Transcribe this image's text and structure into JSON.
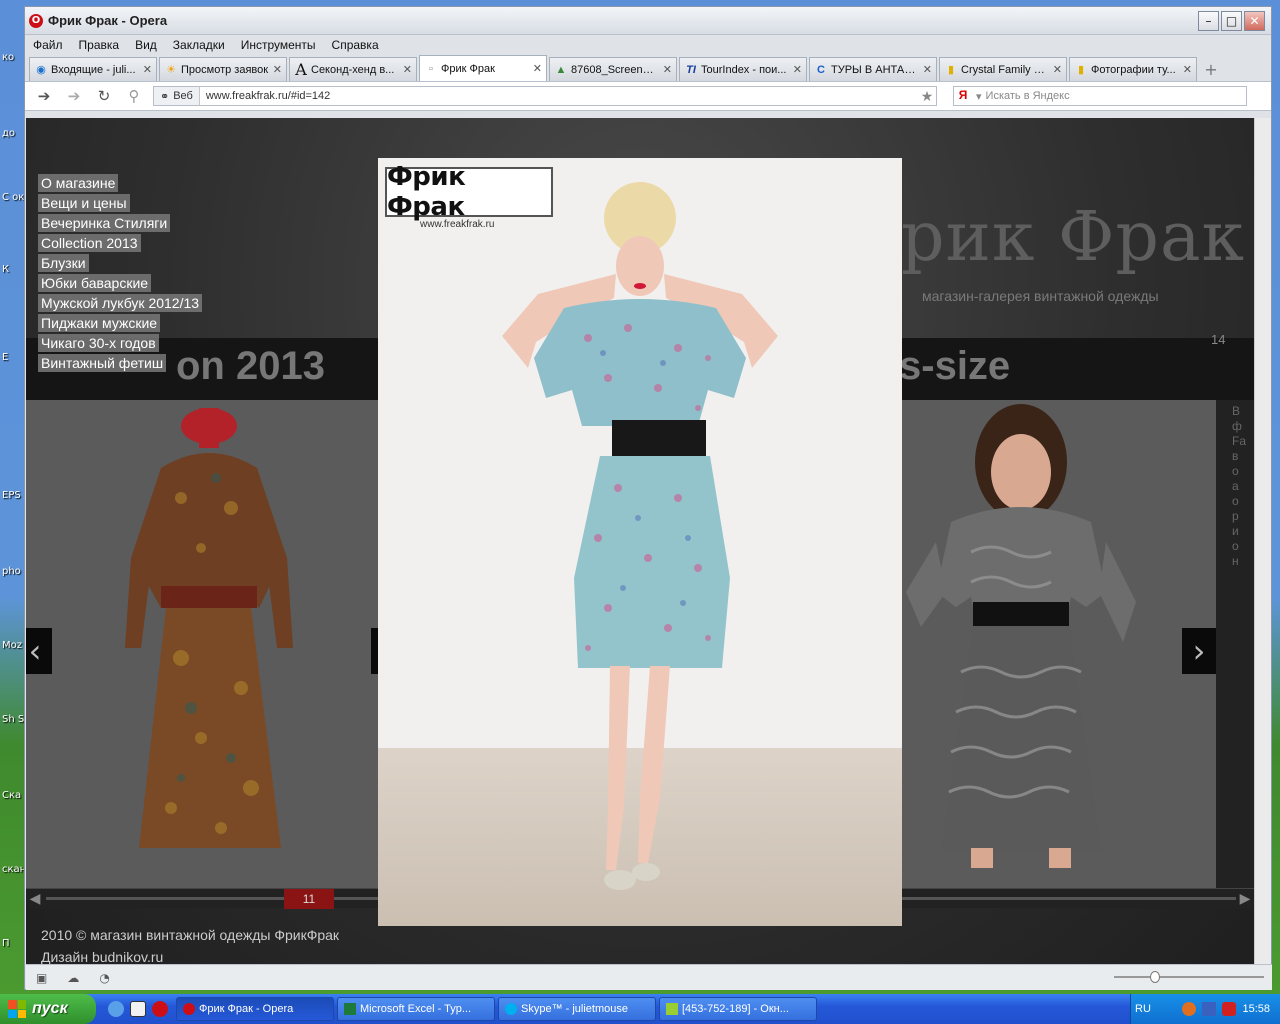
{
  "window": {
    "title": "Фрик Фрак - Opera"
  },
  "menu": [
    "Файл",
    "Правка",
    "Вид",
    "Закладки",
    "Инструменты",
    "Справка"
  ],
  "tabs": [
    {
      "label": "Входящие - juli...",
      "icon": "mail-icon",
      "active": false
    },
    {
      "label": "Просмотр заявок",
      "icon": "sun-icon",
      "active": false
    },
    {
      "label": "Секонд-хенд в...",
      "icon": "font-a-icon",
      "active": false
    },
    {
      "label": "Фрик Фрак",
      "icon": "page-icon",
      "active": true
    },
    {
      "label": "87608_ScreenS...",
      "icon": "image-icon",
      "active": false
    },
    {
      "label": "TourIndex - пои...",
      "icon": "tourindex-icon",
      "active": false
    },
    {
      "label": "ТУРЫ В АНТАЛ...",
      "icon": "refresh-c-icon",
      "active": false
    },
    {
      "label": "Crystal Family R...",
      "icon": "bookmark-icon",
      "active": false
    },
    {
      "label": "Фотографии ту...",
      "icon": "bookmark-icon",
      "active": false
    }
  ],
  "address": {
    "badge": "Веб",
    "url": "www.freakfrak.ru/#id=142"
  },
  "search": {
    "placeholder": "Искать в Яндекс",
    "engine": "Я"
  },
  "site": {
    "brand": "Фрик Фрак",
    "brand_partial": "рик Фрак",
    "tagline": "магазин-галерея винтажной одежды",
    "nav": [
      "О магазине",
      "Вещи и цены",
      "Вечеринка Стиляги",
      "Collection 2013",
      "Блузки",
      "Юбки баварские",
      "Мужской лукбук 2012/13",
      "Пиджаки мужские",
      "Чикаго 30-х годов",
      "Винтажный фетиш"
    ],
    "band_left": "Collection 2013",
    "band_left_visible": "on 2013",
    "band_right": "s-size",
    "slide_number": "14",
    "right_text": [
      "В",
      "ф",
      "Fa",
      "в",
      "о",
      "а",
      "о",
      "р",
      "и",
      "о",
      "н"
    ],
    "pager_active": "11",
    "footer_line1": "2010 © магазин винтажной одежды ФрикФрак",
    "footer_line2": "Дизайн budnikov.ru",
    "lightbox_logo": "Фрик Фрак",
    "lightbox_url": "www.freakfrak.ru"
  },
  "taskbar": {
    "start": "пуск",
    "tasks": [
      {
        "label": "Фрик Фрак - Opera",
        "active": true
      },
      {
        "label": "Microsoft Excel - Typ...",
        "active": false
      },
      {
        "label": "Skype™ - julietmouse",
        "active": false
      },
      {
        "label": "[453-752-189] - Окн...",
        "active": false
      }
    ],
    "lang": "RU",
    "clock": "15:58"
  },
  "desktop_icons": [
    "ко",
    "до",
    "С ок",
    "К",
    "E",
    "EPS",
    "pho",
    "Moz",
    "Sh S",
    "Ска",
    "скан",
    "П"
  ],
  "colors": {
    "opera_red": "#cc0f16",
    "pager_red": "#8a1414",
    "taskbar_blue": "#2558d8",
    "start_green": "#3a9b36"
  }
}
